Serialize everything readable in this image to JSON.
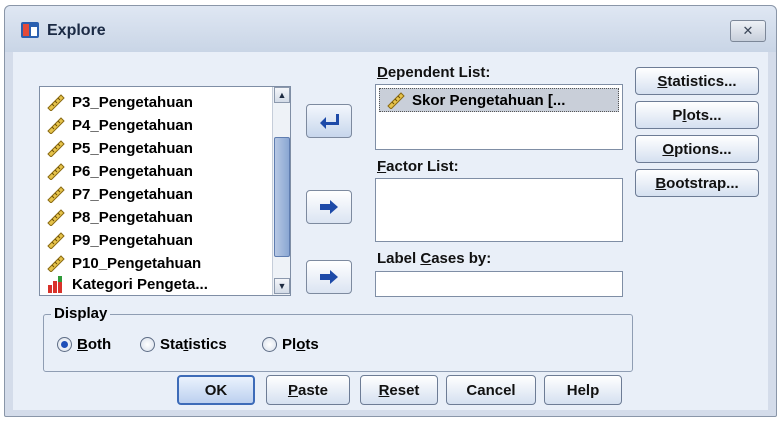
{
  "window": {
    "title": "Explore",
    "close_glyph": "✕"
  },
  "source_list": {
    "items": [
      {
        "label": "P3_Pengetahuan",
        "icon": "ruler-scale-icon"
      },
      {
        "label": "P4_Pengetahuan",
        "icon": "ruler-scale-icon"
      },
      {
        "label": "P5_Pengetahuan",
        "icon": "ruler-scale-icon"
      },
      {
        "label": "P6_Pengetahuan",
        "icon": "ruler-scale-icon"
      },
      {
        "label": "P7_Pengetahuan",
        "icon": "ruler-scale-icon"
      },
      {
        "label": "P8_Pengetahuan",
        "icon": "ruler-scale-icon"
      },
      {
        "label": "P9_Pengetahuan",
        "icon": "ruler-scale-icon"
      },
      {
        "label": "P10_Pengetahuan",
        "icon": "ruler-scale-icon"
      },
      {
        "label": "Kategori Pengeta...",
        "icon": "bar-chart-ordinal-icon"
      }
    ]
  },
  "dependent_list": {
    "label_prefix": "",
    "label_mnemonic": "D",
    "label_rest": "ependent List:",
    "items": [
      {
        "label": "Skor Pengetahuan [...",
        "icon": "ruler-scale-icon"
      }
    ]
  },
  "factor_list": {
    "label_mnemonic": "F",
    "label_rest": "actor List:"
  },
  "label_cases": {
    "label_before": "Label ",
    "label_mnemonic": "C",
    "label_after": "ases by:",
    "value": ""
  },
  "side_buttons": {
    "statistics": {
      "mnemonic": "S",
      "rest": "tatistics..."
    },
    "plots": {
      "before": "P",
      "mnemonic": "l",
      "rest": "ots..."
    },
    "options": {
      "mnemonic": "O",
      "rest": "ptions..."
    },
    "bootstrap": {
      "mnemonic": "B",
      "rest": "ootstrap..."
    }
  },
  "display": {
    "legend": "Display",
    "options": [
      {
        "mnemonic": "B",
        "rest": "oth",
        "selected": true
      },
      {
        "before": "Sta",
        "mnemonic": "t",
        "rest": "istics",
        "selected": false
      },
      {
        "before": "Pl",
        "mnemonic": "o",
        "rest": "ts",
        "selected": false
      }
    ]
  },
  "bottom_buttons": {
    "ok": "OK",
    "paste": {
      "mnemonic": "P",
      "rest": "aste"
    },
    "reset": {
      "mnemonic": "R",
      "rest": "eset"
    },
    "cancel": "Cancel",
    "help": "Help"
  },
  "colors": {
    "accent_blue": "#1f4fb8",
    "dialog_bg": "#e9eff8"
  }
}
